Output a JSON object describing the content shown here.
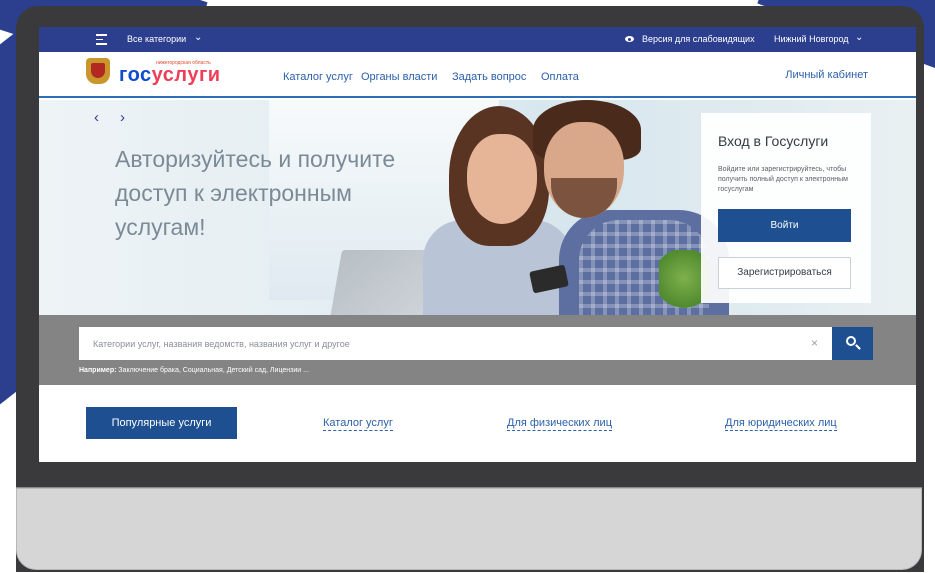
{
  "topbar": {
    "categories_label": "Все категории",
    "vision_label": "Версия для слабовидящих",
    "city_label": "Нижний Новгород"
  },
  "header": {
    "region": "нижегородская область",
    "logo_part1": "гос",
    "logo_part2": "услуги",
    "nav": [
      "Каталог услуг",
      "Органы власти",
      "Задать вопрос",
      "Оплата"
    ],
    "cabinet_label": "Личный кабинет"
  },
  "hero": {
    "prev_arrow": "‹",
    "next_arrow": "›",
    "title": "Авторизуйтесь и получите доступ к электронным услугам!"
  },
  "login": {
    "title": "Вход в Госуслуги",
    "description": "Войдите или зарегистрируйтесь, чтобы получить полный доступ к электронным госуслугам",
    "enter_label": "Войти",
    "register_label": "Зарегистрироваться"
  },
  "search": {
    "placeholder": "Категории услуг, названия ведомств, названия услуг и другое",
    "clear_symbol": "×",
    "examples_prefix": "Например:",
    "examples": "Заключение брака, Социальная, Детский сад, Лицензии ..."
  },
  "tabs": {
    "popular": "Популярные услуги",
    "catalog": "Каталог услуг",
    "physical": "Для физических лиц",
    "legal": "Для юридических лиц"
  },
  "colors": {
    "brand_blue": "#2c3f8f",
    "button_blue": "#1d4f91",
    "link_blue": "#2b5fa8",
    "logo_blue": "#0d4cd3",
    "logo_red": "#ee3f58"
  },
  "icons": [
    "menu-icon",
    "chevron-down-icon",
    "eye-icon",
    "coat-of-arms-icon",
    "close-icon",
    "search-icon"
  ]
}
